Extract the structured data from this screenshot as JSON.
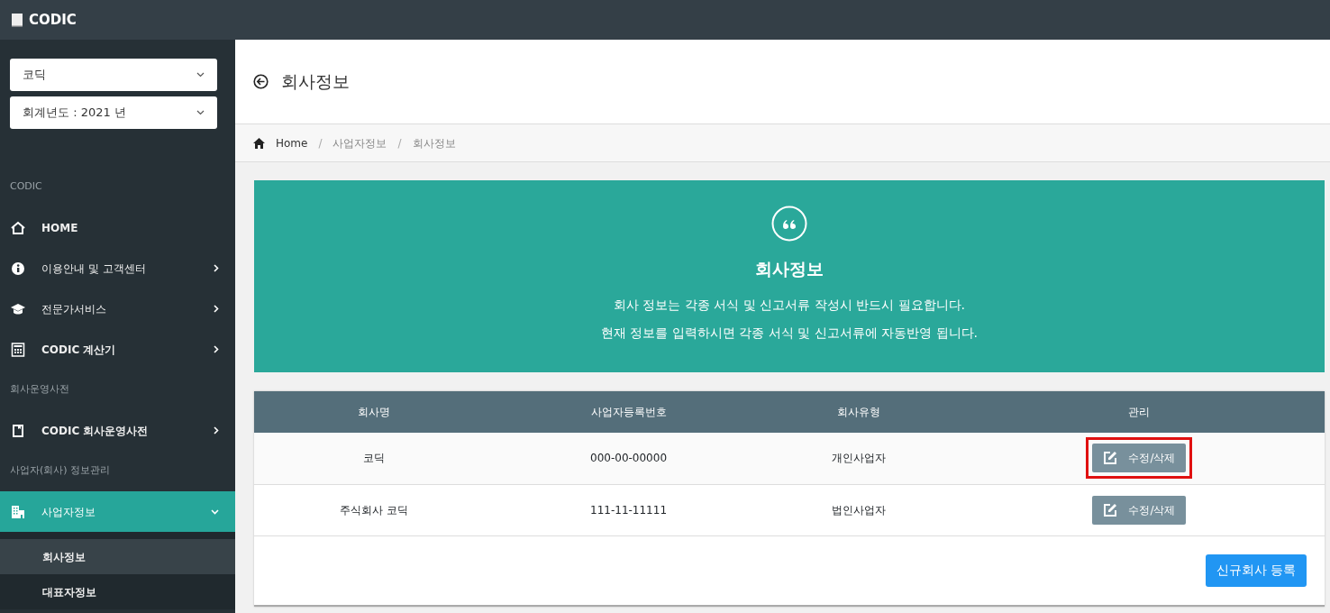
{
  "brand": "CODIC",
  "selects": [
    {
      "value": "코딕"
    },
    {
      "value": "회계년도 : 2021 년"
    }
  ],
  "sidebar": [
    {
      "kind": "header",
      "label": "CODIC"
    },
    {
      "kind": "link",
      "label": "HOME",
      "bold": true,
      "selected": false
    },
    {
      "kind": "menu",
      "label": "이용안내 및 고객센터",
      "bold": false,
      "expanded": false,
      "selected": false
    },
    {
      "kind": "menu",
      "label": "전문가서비스",
      "bold": false,
      "expanded": false,
      "selected": false
    },
    {
      "kind": "menu",
      "label": "CODIC 계산기",
      "bold": true,
      "expanded": false,
      "selected": false
    },
    {
      "kind": "header",
      "label": "회사운영사전"
    },
    {
      "kind": "menu",
      "label": "CODIC 회사운영사전",
      "bold": true,
      "expanded": false,
      "selected": false
    },
    {
      "kind": "header",
      "label": "사업자(회사) 정보관리"
    },
    {
      "kind": "menu",
      "label": "사업자정보",
      "bold": false,
      "expanded": true,
      "selected": true,
      "children": [
        {
          "label": "회사정보",
          "selected": true
        },
        {
          "label": "대표자정보",
          "selected": false
        }
      ]
    }
  ],
  "page_title": "회사정보",
  "breadcrumb": [
    {
      "kind": "link",
      "label": "Home"
    },
    {
      "kind": "separator",
      "label": "/"
    },
    {
      "kind": "link",
      "label": "사업자정보"
    },
    {
      "kind": "separator",
      "label": "/"
    },
    {
      "kind": "current",
      "label": "회사정보"
    }
  ],
  "banner": {
    "title": "회사정보",
    "lines": [
      "회사 정보는 각종 서식 및 신고서류 작성시 반드시 필요합니다.",
      "현재 정보를 입력하시면 각종 서식 및 신고서류에 자동반영 됩니다."
    ]
  },
  "table": {
    "columns": [
      "회사명",
      "사업자등록번호",
      "회사유형",
      "관리"
    ],
    "rows": [
      {
        "cells": [
          "코딕",
          "000-00-00000",
          "개인사업자"
        ],
        "action": "수정/삭제",
        "highlighted": true
      },
      {
        "cells": [
          "주식회사 코딕",
          "111-11-11111",
          "법인사업자"
        ],
        "action": "수정/삭제",
        "highlighted": false
      }
    ]
  },
  "new_button": "신규회사 등록"
}
